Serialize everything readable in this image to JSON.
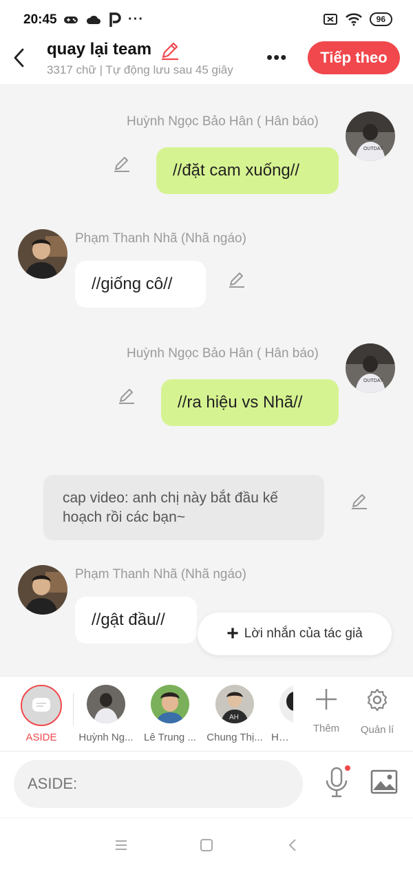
{
  "status_bar": {
    "time": "20:45",
    "battery": "96",
    "overflow": "···"
  },
  "header": {
    "title": "quay lại team",
    "subtitle": "3317 chữ | Tự động lưu sau 45 giây",
    "next_label": "Tiếp theo"
  },
  "messages": [
    {
      "sender": "Huỳnh Ngọc Bảo Hân ( Hân báo)",
      "text": "//đặt cam xuống//",
      "side": "right"
    },
    {
      "sender": "Phạm Thanh Nhã (Nhã ngáo)",
      "text": "//giống cô//",
      "side": "left"
    },
    {
      "sender": "Huỳnh Ngọc Bảo Hân ( Hân báo)",
      "text": "//ra hiệu vs Nhã//",
      "side": "right"
    },
    {
      "sender": "Phạm Thanh Nhã (Nhã ngáo)",
      "text": "//gật đầu//",
      "side": "left"
    }
  ],
  "narration": "cap video: anh chị này bắt đầu kế hoạch rồi các bạn~",
  "author_note_label": "Lời nhắn của tác giả",
  "characters": {
    "aside_label": "ASIDE",
    "list": [
      "Huỳnh Ng...",
      "Lê Trung ...",
      "Chung Thị...",
      "Huỳn"
    ],
    "add_label": "Thêm",
    "manage_label": "Quản lí"
  },
  "input": {
    "placeholder": "ASIDE:"
  },
  "colors": {
    "accent": "#f0484d",
    "green_bubble": "#d6f391",
    "background": "#f4f4f4"
  }
}
